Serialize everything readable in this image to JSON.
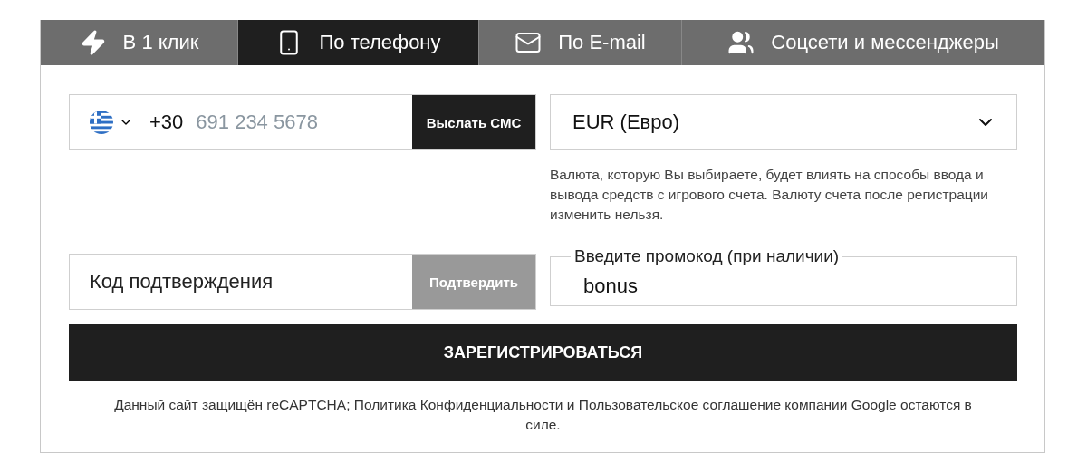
{
  "tabs": [
    {
      "label": "В 1 клик",
      "kind": "bolt",
      "selected": false
    },
    {
      "label": "По телефону",
      "kind": "phone",
      "selected": true
    },
    {
      "label": "По E-mail",
      "kind": "mail",
      "selected": false
    },
    {
      "label": "Соцсети и мессенджеры",
      "kind": "people",
      "selected": false
    }
  ],
  "phone": {
    "country_code": "+30",
    "placeholder": "691 234 5678",
    "send_button": "Выслать СМС"
  },
  "currency": {
    "value": "EUR (Евро)",
    "note": "Валюта, которую Вы выбираете, будет влиять на способы ввода и вывода средств с игрового счета. Валюту счета после регистрации изменить нельзя."
  },
  "code": {
    "placeholder": "Код подтверждения",
    "confirm_button": "Подтвердить",
    "disabled": true
  },
  "promo": {
    "label": "Введите промокод (при наличии)",
    "value": "bonus"
  },
  "register_button": "ЗАРЕГИСТРИРОВАТЬСЯ",
  "footer": "Данный сайт защищён reCAPTCHA; Политика Конфиденциальности и Пользовательское соглашение компании Google остаются в силе."
}
